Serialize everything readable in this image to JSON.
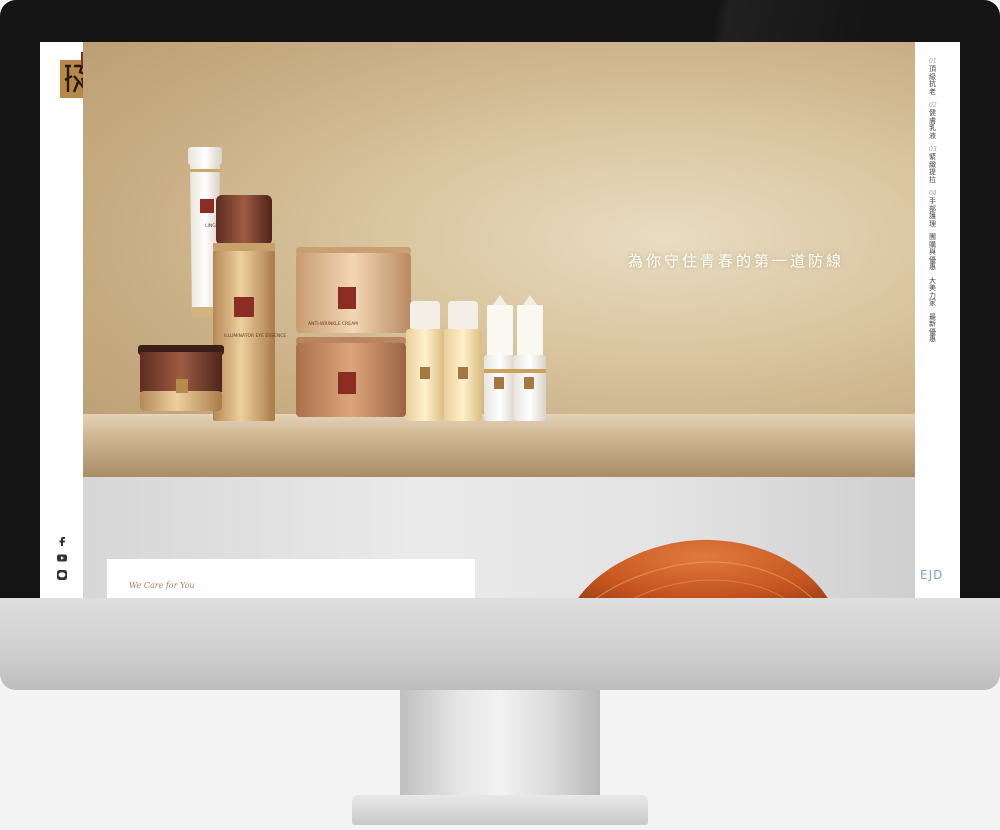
{
  "hero": {
    "tagline": "為你守住青春的第一道防線"
  },
  "care": {
    "text": "We Care for You"
  },
  "nav": {
    "items": [
      {
        "num": "01",
        "label": "頂級抗老"
      },
      {
        "num": "02",
        "label": "健膚乳液"
      },
      {
        "num": "03",
        "label": "緊緻提拉"
      },
      {
        "num": "04",
        "label": "手部護理"
      },
      {
        "num": "",
        "label": "團購與優惠"
      },
      {
        "num": "",
        "label": "大美力家"
      },
      {
        "num": "",
        "label": "最新優惠"
      }
    ]
  },
  "brand": {
    "footer_logo": "EJD"
  },
  "products": {
    "tube_label": "LINGZHI HAND CREAM",
    "bottle_label": "ILLUMINATOR EYE ESSENCE",
    "jar_label": "ANTI-WRINKLE CREAM"
  },
  "icons": [
    "facebook-icon",
    "youtube-icon",
    "line-icon"
  ],
  "colors": {
    "accent_gold": "#a1855a",
    "hero_gold": "#d9c59f",
    "bronze": "#8a4a2a"
  }
}
